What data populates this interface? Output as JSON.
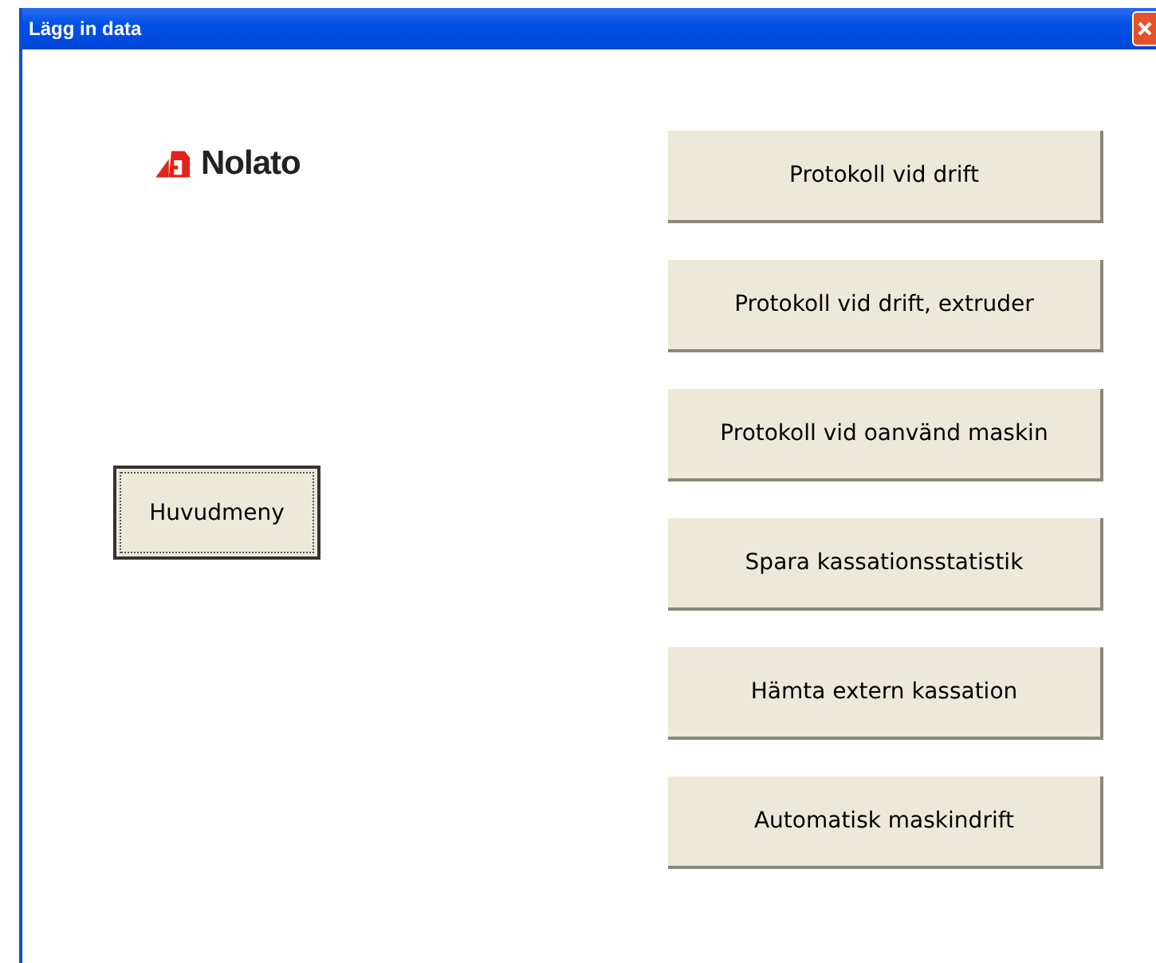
{
  "window": {
    "title": "Lägg in data"
  },
  "logo": {
    "text": "Nolato"
  },
  "main_menu_button": {
    "label": "Huvudmeny",
    "focused": true
  },
  "buttons": [
    {
      "label": "Protokoll vid drift",
      "focused": false
    },
    {
      "label": "Protokoll vid drift, extruder",
      "focused": false
    },
    {
      "label": "Protokoll vid oanvänd maskin",
      "focused": false
    },
    {
      "label": "Spara kassationsstatistik",
      "focused": false
    },
    {
      "label": "Hämta extern kassation",
      "focused": false
    },
    {
      "label": "Automatisk maskindrift",
      "focused": false
    }
  ]
}
